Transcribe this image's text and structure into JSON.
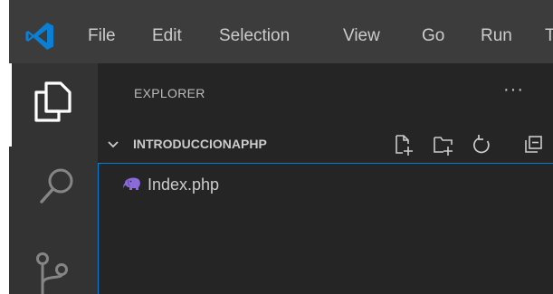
{
  "menu": {
    "items": [
      "File",
      "Edit",
      "Selection",
      "View",
      "Go",
      "Run",
      "T"
    ]
  },
  "explorer": {
    "title": "EXPLORER",
    "more_actions": "···",
    "folder": {
      "name": "INTRODUCCIONAPHP",
      "expanded": true,
      "actions": [
        "new-file-icon",
        "new-folder-icon",
        "refresh-icon",
        "collapse-all-icon"
      ]
    },
    "files": [
      {
        "name": "Index.php",
        "icon": "php-elephant-icon"
      }
    ]
  },
  "activity_bar": {
    "items": [
      "explorer-icon",
      "search-icon",
      "source-control-icon"
    ],
    "active": "explorer-icon"
  },
  "colors": {
    "titlebar": "#3c3c3c",
    "activitybar": "#333333",
    "sidebar": "#252526",
    "text": "#cccccc",
    "focus_border": "#007fd4",
    "logo": "#0a7fd4",
    "php": "#8a6bd8"
  }
}
